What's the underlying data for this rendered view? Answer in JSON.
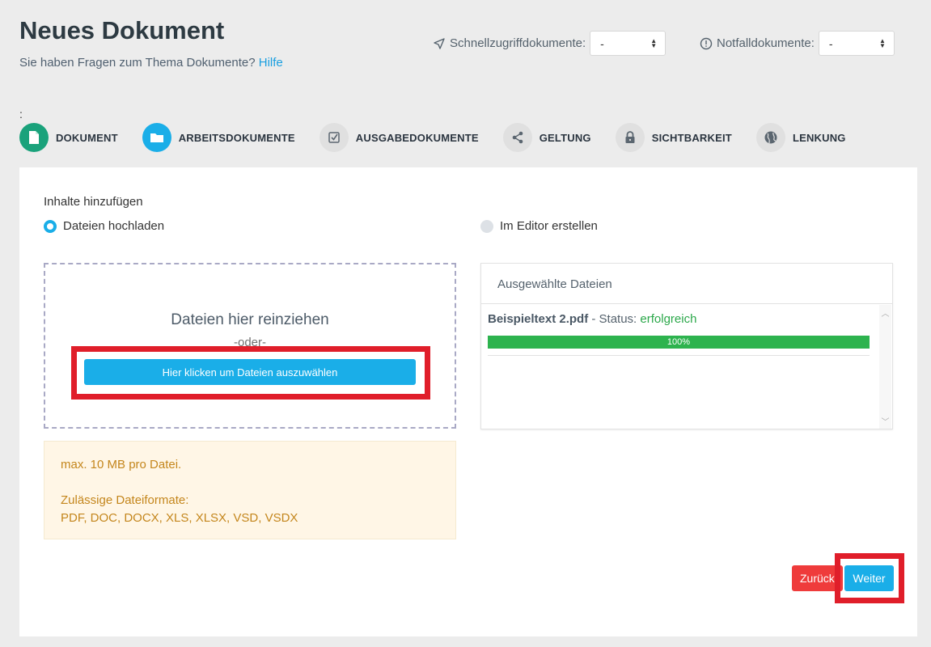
{
  "header": {
    "title": "Neues Dokument",
    "subtitle": "Sie haben Fragen zum Thema Dokumente?",
    "help_link": "Hilfe"
  },
  "quick_access": {
    "label": "Schnellzugriffdokumente:",
    "value": "-",
    "icon": "send-arrow-icon"
  },
  "emergency": {
    "label": "Notfalldokumente:",
    "value": "-",
    "icon": "alert-circle-icon"
  },
  "steps_prefix": ":",
  "steps": [
    {
      "label": "DOKUMENT",
      "icon": "document-icon",
      "state": "done"
    },
    {
      "label": "ARBEITSDOKUMENTE",
      "icon": "folder-icon",
      "state": "active"
    },
    {
      "label": "AUSGABEDOKUMENTE",
      "icon": "checkbox-icon",
      "state": "todo"
    },
    {
      "label": "GELTUNG",
      "icon": "share-icon",
      "state": "todo"
    },
    {
      "label": "SICHTBARKEIT",
      "icon": "lock-icon",
      "state": "todo"
    },
    {
      "label": "LENKUNG",
      "icon": "globe-icon",
      "state": "todo"
    }
  ],
  "content": {
    "section_label": "Inhalte hinzufügen",
    "option_upload": "Dateien hochladen",
    "option_editor": "Im Editor erstellen",
    "selected_option": "upload"
  },
  "dropzone": {
    "title": "Dateien hier reinziehen",
    "or": "-oder-",
    "button": "Hier klicken um Dateien auszuwählen"
  },
  "info": {
    "max_size": "max. 10 MB pro Datei.",
    "formats_label": "Zulässige Dateiformate:",
    "formats": "PDF, DOC, DOCX, XLS, XLSX, VSD, VSDX"
  },
  "selected_files": {
    "title": "Ausgewählte Dateien",
    "items": [
      {
        "name": "Beispieltext 2.pdf",
        "status_label": "- Status:",
        "status": "erfolgreich",
        "progress_text": "100%",
        "progress": 1.0
      }
    ]
  },
  "actions": {
    "back": "Zurück",
    "next": "Weiter"
  },
  "colors": {
    "accent": "#1aaee8",
    "success": "#2db34e",
    "danger": "#ef3b3b",
    "highlight": "#e01e2a",
    "step_done": "#1aa27b"
  }
}
